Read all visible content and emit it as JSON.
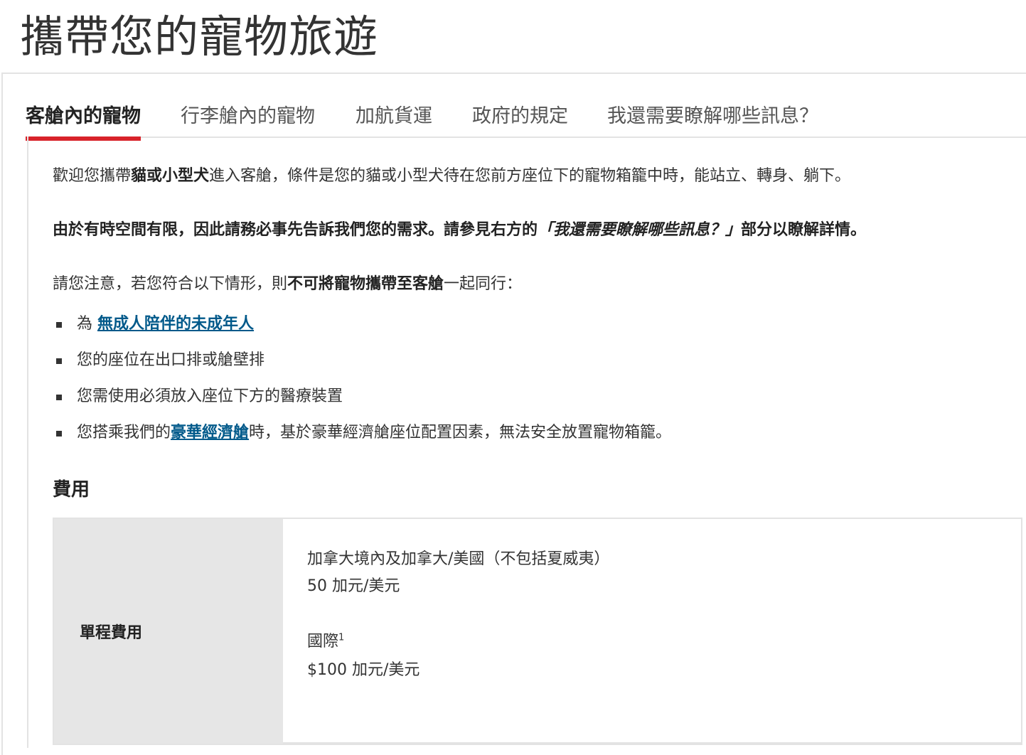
{
  "page": {
    "title": "攜帶您的寵物旅遊"
  },
  "tabs": [
    {
      "label": "客艙內的寵物",
      "active": true
    },
    {
      "label": "行李艙內的寵物",
      "active": false
    },
    {
      "label": "加航貨運",
      "active": false
    },
    {
      "label": "政府的規定",
      "active": false
    },
    {
      "label": "我還需要瞭解哪些訊息？",
      "active": false
    }
  ],
  "intro": {
    "p1_a": "歡迎您攜帶",
    "p1_b": "貓或小型犬",
    "p1_c": "進入客艙，條件是您的貓或小型犬待在您前方座位下的寵物箱籠中時，能站立、轉身、躺下。",
    "p2_a": "由於有時空間有限，因此請務必事先告訴我們您的需求。請參見右方的",
    "p2_b": "「我還需要瞭解哪些訊息？」",
    "p2_c": "部分以瞭解詳情。",
    "p3_a": "請您注意，若您符合以下情形，則",
    "p3_b": "不可將寵物攜帶至客艙",
    "p3_c": "一起同行："
  },
  "conditions": {
    "item1_prefix": "為 ",
    "item1_link": "無成人陪伴的未成年人",
    "item2": "您的座位在出口排或艙壁排",
    "item3": "您需使用必須放入座位下方的醫療裝置",
    "item4_prefix": "您搭乘我們的",
    "item4_link": "豪華經濟艙",
    "item4_suffix": "時，基於豪華經濟艙座位配置因素，無法安全放置寵物箱籠。"
  },
  "fees": {
    "heading": "費用",
    "row_label": "單程費用",
    "domestic_label": "加拿大境內及加拿大/美國（不包括夏威夷）",
    "domestic_price": "50 加元/美元",
    "intl_label": "國際",
    "intl_note": "1",
    "intl_price": "$100 加元/美元"
  },
  "colors": {
    "accent": "#d8232a",
    "link": "#00598a",
    "label_bg": "#e6e6e6"
  }
}
